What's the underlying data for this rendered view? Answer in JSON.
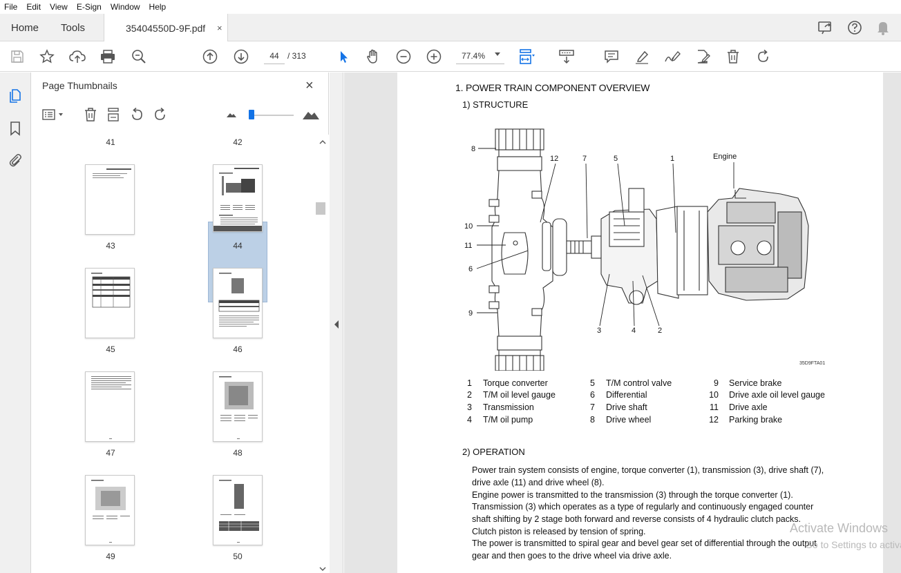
{
  "menu": [
    "File",
    "Edit",
    "View",
    "E-Sign",
    "Window",
    "Help"
  ],
  "tabs": {
    "home": "Home",
    "tools": "Tools",
    "document": "35404550D-9F.pdf",
    "close": "×"
  },
  "toolbar": {
    "current_page": "44",
    "total_pages": "/ 313",
    "zoom": "77.4%"
  },
  "icons": {
    "menu_right": [
      "share-icon",
      "help-icon",
      "bell-icon"
    ],
    "toolbar": [
      "save-icon",
      "star-icon",
      "upload-icon",
      "print-icon",
      "search-zoom-icon",
      "prev-page-icon",
      "next-page-icon",
      "select-arrow-icon",
      "hand-icon",
      "zoom-out-icon",
      "zoom-in-icon",
      "fit-page-icon",
      "scroll-mode-icon",
      "comment-icon",
      "highlight-icon",
      "sign-icon",
      "edit-pdf-icon",
      "delete-icon",
      "rotate-icon"
    ]
  },
  "panel": {
    "title": "Page Thumbnails",
    "close": "×",
    "thumbnails": [
      {
        "label": "41"
      },
      {
        "label": "42"
      },
      {
        "label": "43"
      },
      {
        "label": "44",
        "selected": true
      },
      {
        "label": "45"
      },
      {
        "label": "46"
      },
      {
        "label": "47"
      },
      {
        "label": "48"
      },
      {
        "label": "49"
      },
      {
        "label": "50"
      }
    ]
  },
  "document": {
    "heading": "1. POWER TRAIN COMPONENT OVERVIEW",
    "structure_heading": "1) STRUCTURE",
    "engine_label": "Engine",
    "callouts": [
      "8",
      "12",
      "7",
      "5",
      "1",
      "10",
      "11",
      "6",
      "9",
      "3",
      "4",
      "2"
    ],
    "figure_code": "35D9FTA01",
    "legend": [
      {
        "num": "1",
        "label": "Torque converter"
      },
      {
        "num": "2",
        "label": "T/M oil level gauge"
      },
      {
        "num": "3",
        "label": "Transmission"
      },
      {
        "num": "4",
        "label": "T/M oil pump"
      },
      {
        "num": "5",
        "label": "T/M control valve"
      },
      {
        "num": "6",
        "label": "Differential"
      },
      {
        "num": "7",
        "label": "Drive shaft"
      },
      {
        "num": "8",
        "label": "Drive wheel"
      },
      {
        "num": "9",
        "label": "Service brake"
      },
      {
        "num": "10",
        "label": "Drive axle oil level gauge"
      },
      {
        "num": "11",
        "label": "Drive axle"
      },
      {
        "num": "12",
        "label": "Parking brake"
      }
    ],
    "operation_heading": "2) OPERATION",
    "paragraphs": [
      "Power train system consists of engine, torque converter (1), transmission (3), drive shaft (7), drive axle (11) and drive wheel (8).",
      "Engine power is transmitted to the transmission (3) through the torque converter (1).",
      "Transmission (3) which operates as a type of regularly and continuously engaged counter shaft shifting by 2 stage both forward and reverse consists of 4 hydraulic clutch packs.",
      "Clutch piston is released by tension of spring.",
      "The power is transmitted to spiral gear and bevel gear set of differential through the output gear and then goes to the drive wheel via drive axle."
    ]
  },
  "watermark": {
    "line1": "Activate Windows",
    "line2": "Go to Settings to activate Windows."
  }
}
